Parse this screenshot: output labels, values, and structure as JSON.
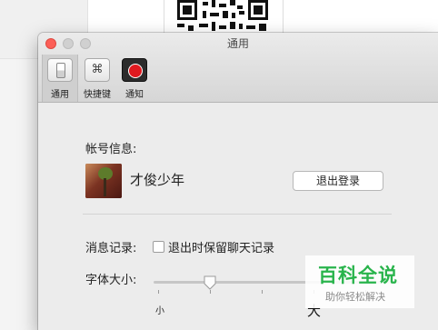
{
  "window": {
    "title": "通用"
  },
  "toolbar": {
    "items": [
      {
        "label": "通用",
        "icon": "switch-icon",
        "active": true
      },
      {
        "label": "快捷键",
        "icon": "command-key-icon",
        "glyph": "⌘",
        "active": false
      },
      {
        "label": "通知",
        "icon": "record-notification-icon",
        "active": false
      }
    ]
  },
  "account": {
    "section_label": "帐号信息:",
    "username": "才俊少年",
    "logout_label": "退出登录"
  },
  "messages": {
    "section_label": "消息记录:",
    "checkbox_label": "退出时保留聊天记录",
    "checked": false
  },
  "font_size": {
    "section_label": "字体大小:",
    "min_label": "小",
    "max_label": "大",
    "level_fraction": 0.22
  },
  "watermark": {
    "title": "百科全说",
    "subtitle": "助你轻松解决"
  },
  "colors": {
    "close_button": "#fc5f57",
    "record_red": "#e0191f",
    "watermark_green": "#29b44c"
  }
}
